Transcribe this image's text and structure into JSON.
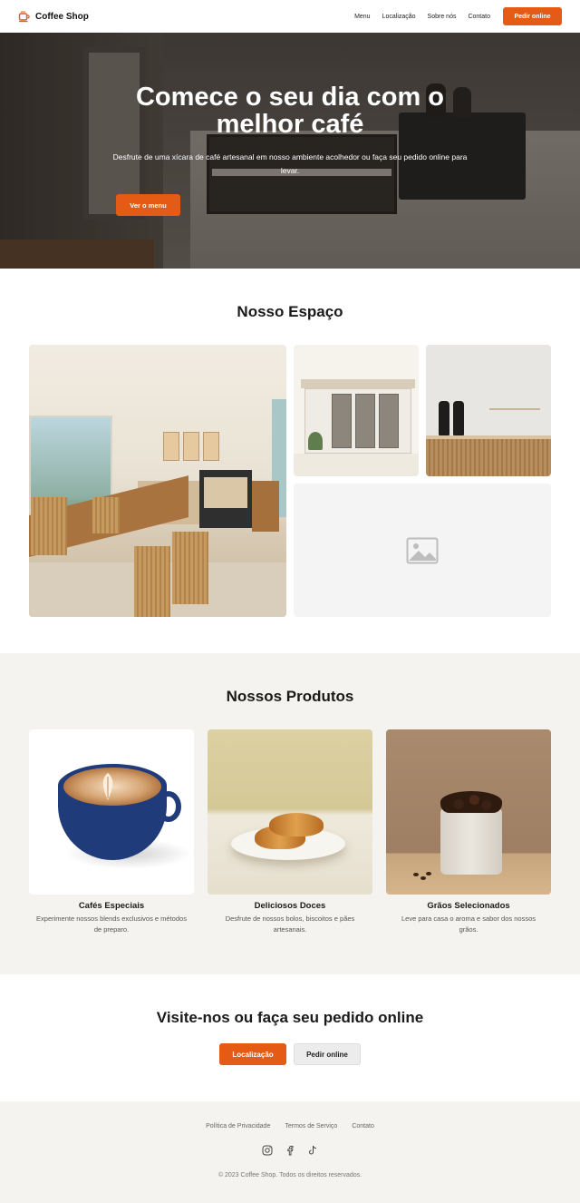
{
  "header": {
    "brand": "Coffee Shop",
    "nav": [
      "Menu",
      "Localização",
      "Sobre nós",
      "Contato"
    ],
    "order_button": "Pedir online"
  },
  "hero": {
    "title": "Comece o seu dia com o melhor café",
    "subtitle": "Desfrute de uma xícara de café artesanal em nosso ambiente acolhedor ou faça seu pedido online para levar.",
    "button": "Ver o menu"
  },
  "space": {
    "title": "Nosso Espaço"
  },
  "products": {
    "title": "Nossos Produtos",
    "items": [
      {
        "name": "Cafés Especiais",
        "desc": "Experimente nossos blends exclusivos e métodos de preparo."
      },
      {
        "name": "Deliciosos Doces",
        "desc": "Desfrute de nossos bolos, biscoitos e pães artesanais."
      },
      {
        "name": "Grãos Selecionados",
        "desc": "Leve para casa o aroma e sabor dos nossos grãos."
      }
    ]
  },
  "cta": {
    "title": "Visite-nos ou faça seu pedido online",
    "location_button": "Localização",
    "order_button": "Pedir online"
  },
  "footer": {
    "links": [
      "Política de Privacidade",
      "Termos de Serviço",
      "Contato"
    ],
    "social_icons": [
      "instagram-icon",
      "facebook-icon",
      "tiktok-icon"
    ],
    "copyright": "© 2023 Coffee Shop. Todos os direitos reservados."
  },
  "colors": {
    "accent": "#e55a14",
    "section_bg": "#f4f3f0",
    "text": "#1a1a1a"
  }
}
